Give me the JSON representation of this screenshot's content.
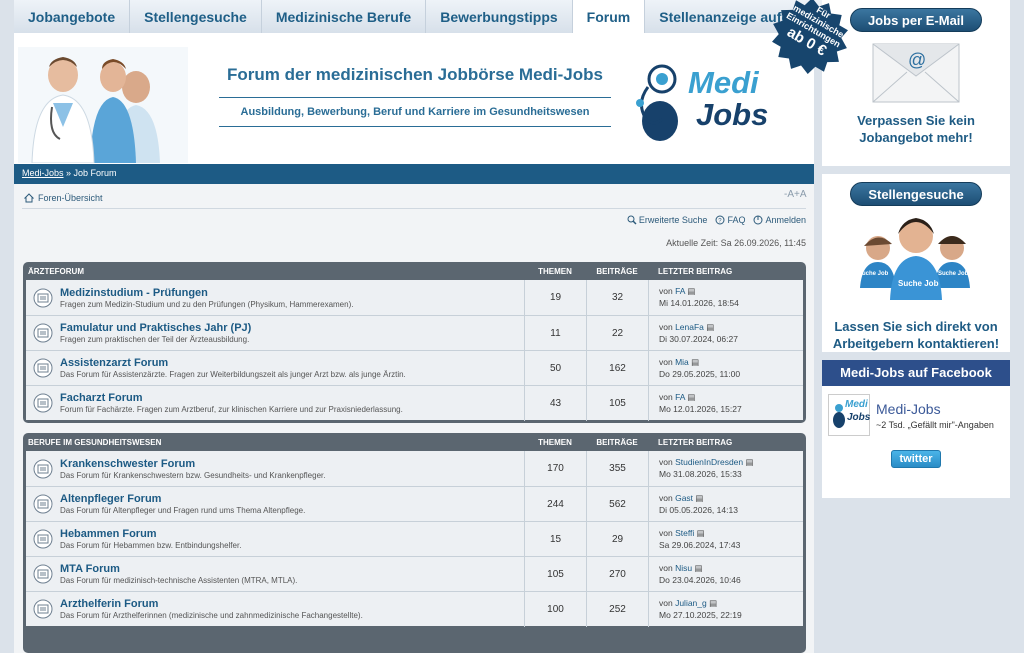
{
  "nav": {
    "tabs": [
      {
        "label": "Jobangebote",
        "active": false
      },
      {
        "label": "Stellengesuche",
        "active": false
      },
      {
        "label": "Medizinische Berufe",
        "active": false
      },
      {
        "label": "Bewerbungstipps",
        "active": false
      },
      {
        "label": "Forum",
        "active": true
      },
      {
        "label": "Stellenanzeige aufgeben",
        "active": false
      }
    ]
  },
  "seal": {
    "line1": "Für",
    "line2": "medizinische",
    "line3": "Einrichtungen",
    "line4": "ab 0 €"
  },
  "header": {
    "title": "Forum der medizinischen Jobbörse Medi-Jobs",
    "subtitle": "Ausbildung, Bewerbung, Beruf und Karriere im Gesundheitswesen",
    "logo_line1": "Medi",
    "logo_line2": "Jobs"
  },
  "breadcrumb": {
    "home": "Medi-Jobs",
    "sep": " » ",
    "current": "Job Forum"
  },
  "overview_link": "Foren-Übersicht",
  "fontsize_control": "-A+A",
  "toplinks": {
    "search": "Erweiterte Suche",
    "faq": "FAQ",
    "login": "Anmelden"
  },
  "current_time": "Aktuelle Zeit: Sa 26.09.2026, 11:45",
  "panels": [
    {
      "header": {
        "section": "ÄRZTEFORUM",
        "topics": "THEMEN",
        "posts": "BEITRÄGE",
        "last": "LETZTER BEITRAG"
      },
      "rows": [
        {
          "title": "Medizinstudium - Prüfungen",
          "desc": "Fragen zum Medizin-Studium und zu den Prüfungen (Physikum, Hammerexamen).",
          "topics": "19",
          "posts": "32",
          "by": "von ",
          "author": "FA",
          "date": "Mi 14.01.2026, 18:54"
        },
        {
          "title": "Famulatur und Praktisches Jahr (PJ)",
          "desc": "Fragen zum praktischen der Teil der Ärzteausbildung.",
          "topics": "11",
          "posts": "22",
          "by": "von ",
          "author": "LenaFa",
          "date": "Di 30.07.2024, 06:27"
        },
        {
          "title": "Assistenzarzt Forum",
          "desc": "Das Forum für Assistenzärzte. Fragen zur Weiterbildungszeit als junger Arzt bzw. als junge Ärztin.",
          "topics": "50",
          "posts": "162",
          "by": "von ",
          "author": "Mia",
          "date": "Do 29.05.2025, 11:00"
        },
        {
          "title": "Facharzt Forum",
          "desc": "Forum für Fachärzte. Fragen zum Arztberuf, zur klinischen Karriere und zur Praxisniederlassung.",
          "topics": "43",
          "posts": "105",
          "by": "von ",
          "author": "FA",
          "date": "Mo 12.01.2026, 15:27"
        }
      ]
    },
    {
      "header": {
        "section": "BERUFE IM GESUNDHEITSWESEN",
        "topics": "THEMEN",
        "posts": "BEITRÄGE",
        "last": "LETZTER BEITRAG"
      },
      "rows": [
        {
          "title": "Krankenschwester Forum",
          "desc": "Das Forum für Krankenschwestern bzw. Gesundheits- und Krankenpfleger.",
          "topics": "170",
          "posts": "355",
          "by": "von ",
          "author": "StudienInDresden",
          "date": "Mo 31.08.2026, 15:33"
        },
        {
          "title": "Altenpfleger Forum",
          "desc": "Das Forum für Altenpfleger und Fragen rund ums Thema Altenpflege.",
          "topics": "244",
          "posts": "562",
          "by": "von ",
          "author": "Gast",
          "date": "Di 05.05.2026, 14:13"
        },
        {
          "title": "Hebammen Forum",
          "desc": "Das Forum für Hebammen bzw. Entbindungshelfer.",
          "topics": "15",
          "posts": "29",
          "by": "von ",
          "author": "Steffi",
          "date": "Sa 29.06.2024, 17:43"
        },
        {
          "title": "MTA Forum",
          "desc": "Das Forum für medizinisch-technische Assistenten (MTRA, MTLA).",
          "topics": "105",
          "posts": "270",
          "by": "von ",
          "author": "Nisu",
          "date": "Do 23.04.2026, 10:46"
        },
        {
          "title": "Arzthelferin Forum",
          "desc": "Das Forum für Arzthelferinnen (medizinische und zahnmedizinische Fachangestellte).",
          "topics": "100",
          "posts": "252",
          "by": "von ",
          "author": "Julian_g",
          "date": "Mo 27.10.2025, 22:19"
        }
      ]
    }
  ],
  "sidebar": {
    "email": {
      "button": "Jobs per E-Mail",
      "text1": "Verpassen Sie kein",
      "text2": "Jobangebot mehr!"
    },
    "gesuche": {
      "button": "Stellengesuche",
      "badge1": "Suche Job",
      "badge2": "Suche Job",
      "badge3": "Suche Job",
      "text1": "Lassen Sie sich direkt von",
      "text2": "Arbeitgebern kontaktieren!"
    },
    "facebook": {
      "header": "Medi-Jobs auf Facebook",
      "name": "Medi-Jobs",
      "likes": "~2 Tsd. „Gefällt mir\"-Angaben",
      "logo1": "Medi",
      "logo2": "Jobs",
      "twitter": "twitter"
    }
  }
}
